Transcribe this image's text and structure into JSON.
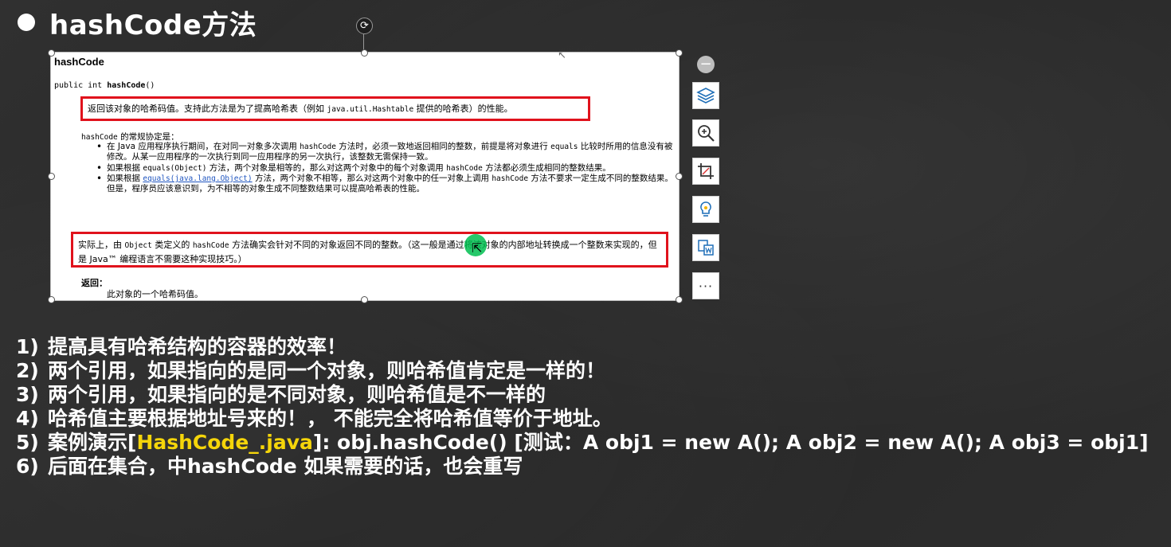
{
  "title": "hashCode方法",
  "doc": {
    "heading": "hashCode",
    "signature_prefix": "public int ",
    "signature_name": "hashCode",
    "signature_suffix": "()",
    "box1_pre": "返回该对象的哈希码值。支持此方法是为了提高哈希表（例如 ",
    "box1_code": "java.util.Hashtable",
    "box1_post": " 提供的哈希表）的性能。",
    "contract_code": "hashCode",
    "contract_intro": " 的常规协定是：",
    "bullet1_a": "在 Java 应用程序执行期间，在对同一对象多次调用 ",
    "bullet1_code1": "hashCode",
    "bullet1_b": " 方法时，必须一致地返回相同的整数，前提是将对象进行 ",
    "bullet1_code2": "equals",
    "bullet1_c": " 比较时所用的信息没有被修改。从某一应用程序的一次执行到同一应用程序的另一次执行，该整数无需保持一致。",
    "bullet2_a": "如果根据 ",
    "bullet2_code1": "equals(Object)",
    "bullet2_b": " 方法，两个对象是相等的，那么对这两个对象中的每个对象调用 ",
    "bullet2_code2": "hashCode",
    "bullet2_c": " 方法都必须生成相同的整数结果。",
    "bullet3_a": "如果根据 ",
    "bullet3_link": "equals(java.lang.Object)",
    "bullet3_b": " 方法，两个对象不相等，那么对这两个对象中的任一对象上调用 ",
    "bullet3_code": "hashCode",
    "bullet3_c": " 方法不要求一定生成不同的整数结果。但是，程序员应该意识到，为不相等的对象生成不同整数结果可以提高哈希表的性能。",
    "box2_a": "实际上，由 ",
    "box2_code1": "Object",
    "box2_b": " 类定义的 ",
    "box2_code2": "hashCode",
    "box2_c": " 方法确实会针对不同的对象返回不同的整数。（这一般是通过将该对象的内部地址转换成一个整数来实现的，但是 Java™ 编程语言不需要这种实现技巧。）",
    "returns_label": "返回：",
    "returns_text": "此对象的一个哈希码值。"
  },
  "toolbar": {
    "minus": "−",
    "more": "···",
    "icons": [
      "layers-icon",
      "zoom-in-icon",
      "crop-icon",
      "lightbulb-icon",
      "word-convert-icon",
      "more-icon"
    ]
  },
  "points": [
    {
      "num": "1)",
      "text": "提高具有哈希结构的容器的效率！"
    },
    {
      "num": "2)",
      "text": "两个引用，如果指向的是同一个对象，则哈希值肯定是一样的！"
    },
    {
      "num": "3)",
      "text": "两个引用，如果指向的是不同对象，则哈希值是不一样的"
    },
    {
      "num": "4)",
      "text": "哈希值主要根据地址号来的！， 不能完全将哈希值等价于地址。"
    },
    {
      "num": "5)",
      "pre": "案例演示[",
      "highlight": "HashCode_.java",
      "post": "]: obj.hashCode()  [测试：A obj1 = new A(); A obj2 = new A(); A obj3 = obj1]"
    },
    {
      "num": "6)",
      "text": "后面在集合，中hashCode 如果需要的话，也会重写"
    }
  ]
}
